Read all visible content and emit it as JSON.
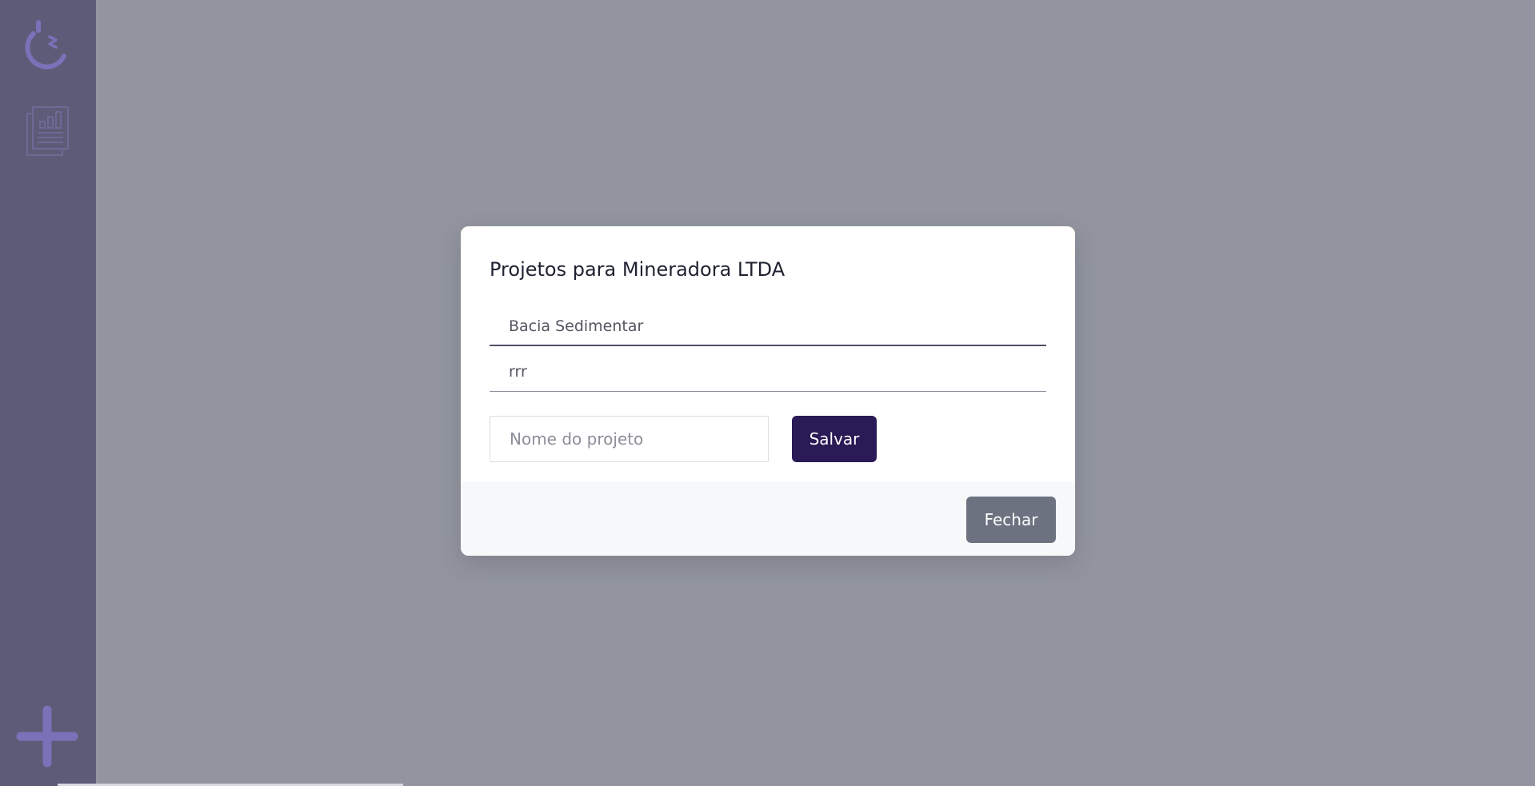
{
  "sidebar": {
    "icons": [
      "logo-icon",
      "reports-icon",
      "add-icon"
    ]
  },
  "modal": {
    "title": "Projetos para Mineradora LTDA",
    "projects": [
      {
        "name": "Bacia Sedimentar"
      },
      {
        "name": "rrr"
      }
    ],
    "new_project": {
      "placeholder": "Nome do projeto",
      "value": ""
    },
    "save_label": "Salvar",
    "close_label": "Fechar"
  },
  "colors": {
    "sidebar_bg": "#5c5c78",
    "overlay_bg": "#92959f",
    "accent_icon": "#7a72b8",
    "primary_button": "#2a1a55",
    "secondary_button": "#6c7280"
  }
}
